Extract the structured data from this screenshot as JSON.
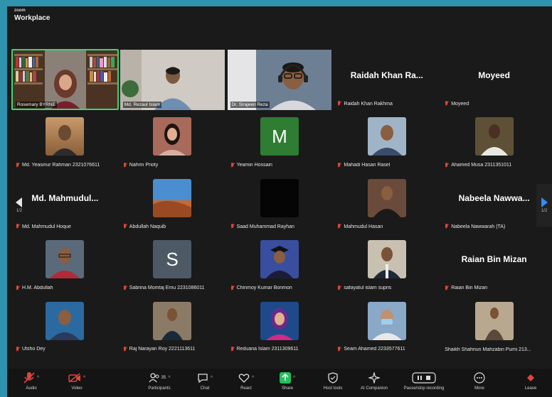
{
  "window": {
    "brand_small": "zoom",
    "brand_big": "Workplace"
  },
  "navigation": {
    "left_page": "1/2",
    "right_page": "1/2"
  },
  "video_tiles": [
    {
      "label": "Rosemary BYRNE"
    },
    {
      "label": "Md. Rezaul Islam"
    },
    {
      "label": "Dr. Sirajeen Reza"
    }
  ],
  "name_tiles": [
    {
      "display_name": "Raidah Khan Ra...",
      "label": "Raidah Khan Rakhma"
    },
    {
      "display_name": "Moyeed",
      "label": "Moyeed"
    }
  ],
  "participants": [
    {
      "label": "Md. Yeasinur Rahman 2321076611"
    },
    {
      "label": "Nahrin Prioty"
    },
    {
      "label": "Yeamin Hossain",
      "letter": "M"
    },
    {
      "label": "Mahadi Hasan Rasel"
    },
    {
      "label": "Ahamed Musa 2311351011"
    },
    {
      "label": "Md. Mahmudul Hoque",
      "display_name": "Md. Mahmudul..."
    },
    {
      "label": "Abdullah Naquib"
    },
    {
      "label": "Saad Muhammad Rayhan"
    },
    {
      "label": "Mahmudul Hasan"
    },
    {
      "label": "Nabeela Nawwarah (TA)",
      "display_name": "Nabeela Nawwa..."
    },
    {
      "label": "H.M. Abdullah"
    },
    {
      "label": "Sabrina Momtaj Emu 2231086011",
      "letter": "S"
    },
    {
      "label": "Chinmoy Kumar Bonmon"
    },
    {
      "label": "safayatul islam supris"
    },
    {
      "label": "Raian Bin Mizan",
      "display_name": "Raian Bin Mizan"
    },
    {
      "label": "Utsho Dey"
    },
    {
      "label": "Raj Narayan Roy 2221113611"
    },
    {
      "label": "Reduana Islam 2311309611"
    },
    {
      "label": "Seam Ahamed 2233577611"
    },
    {
      "label": "Shaikh Shahnun Mahzabin Purni 213..."
    }
  ],
  "toolbar": {
    "audio": "Audio",
    "video": "Video",
    "participants": "Participants",
    "participants_count": "35",
    "chat": "Chat",
    "react": "React",
    "share": "Share",
    "host_tools": "Host tools",
    "ai_companion": "AI Companion",
    "pause_recording": "Pause/stop recording",
    "more": "More",
    "leave": "Leave"
  },
  "colors": {
    "accent_green": "#3bd672",
    "muted_red": "#e0453b",
    "share_green": "#23c05d",
    "frame_teal": "#2f93ad"
  }
}
